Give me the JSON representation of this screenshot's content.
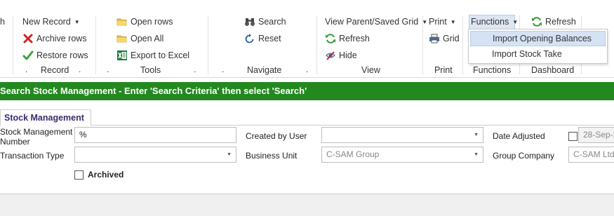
{
  "ribbon": {
    "left_cut_label": "h",
    "record": {
      "new_record": "New Record",
      "archive_rows": "Archive rows",
      "restore_rows": "Restore rows",
      "group_label": "Record"
    },
    "tools": {
      "open_rows": "Open rows",
      "open_all": "Open All",
      "export_to_excel": "Export to Excel",
      "group_label": "Tools"
    },
    "navigate": {
      "search": "Search",
      "reset": "Reset",
      "group_label": "Navigate"
    },
    "view": {
      "view_parent": "View Parent/Saved Grid",
      "refresh": "Refresh",
      "hide": "Hide",
      "group_label": "View"
    },
    "print": {
      "print": "Print",
      "grid": "Grid",
      "group_label": "Print"
    },
    "functions": {
      "functions": "Functions",
      "group_label": "Functions"
    },
    "dashboard": {
      "refresh": "Refresh",
      "group_label": "Dashboard"
    },
    "group_dot": "."
  },
  "functions_menu": {
    "items": [
      "Import Opening Balances",
      "Import Stock Take"
    ]
  },
  "banner": {
    "text": "Search Stock Management - Enter 'Search Criteria' then select 'Search'"
  },
  "tab": {
    "label": "Stock Management"
  },
  "form": {
    "stock_management_number_label_1": "Stock Management",
    "stock_management_number_label_2": "Number",
    "stock_management_number_value": "%",
    "transaction_type_label": "Transaction Type",
    "transaction_type_value": "",
    "archived_label": "Archived",
    "created_by_user_label": "Created by User",
    "created_by_user_value": "",
    "business_unit_label": "Business Unit",
    "business_unit_value": "C-SAM Group",
    "date_adjusted_label": "Date Adjusted",
    "date_adjusted_value": "28-Sep-2",
    "group_company_label": "Group Company",
    "group_company_value": "C-SAM Ltd"
  },
  "colors": {
    "banner_green": "#23891f",
    "tab_text": "#3c2a6e",
    "menu_highlight": "#d5e2f4"
  }
}
